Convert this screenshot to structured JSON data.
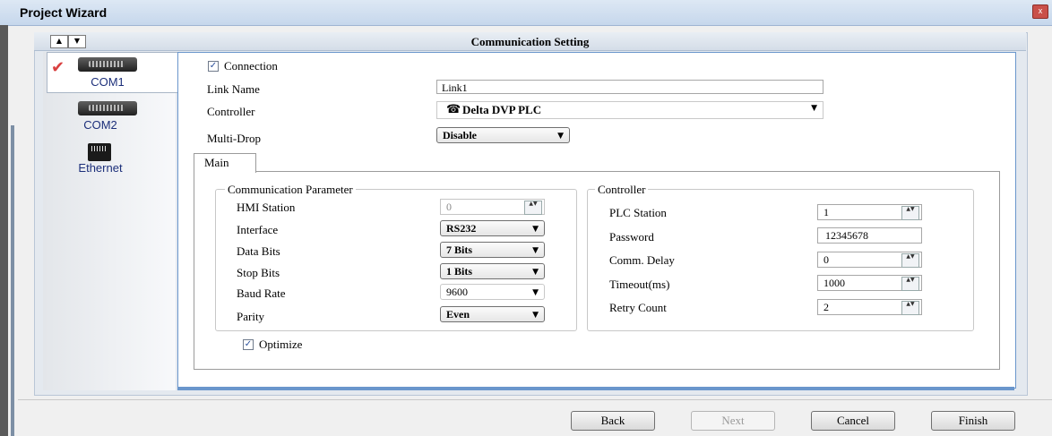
{
  "window": {
    "title": "Project Wizard",
    "close_label": "x"
  },
  "panel": {
    "title": "Communication Setting",
    "up_arrow": "▲",
    "down_arrow": "▼"
  },
  "sidebar": {
    "items": [
      {
        "label": "COM1",
        "icon": "serial-port-icon",
        "selected": true
      },
      {
        "label": "COM2",
        "icon": "serial-port-icon",
        "selected": false
      },
      {
        "label": "Ethernet",
        "icon": "ethernet-port-icon",
        "selected": false
      }
    ],
    "check_glyph": "✔"
  },
  "connection": {
    "checkbox_label": "Connection",
    "checked": true,
    "link_name_label": "Link Name",
    "link_name_value": "Link1",
    "controller_label": "Controller",
    "controller_value": "Delta DVP PLC",
    "multidrop_label": "Multi-Drop",
    "multidrop_value": "Disable"
  },
  "tabs": [
    {
      "label": "Main",
      "active": true
    }
  ],
  "comm_params": {
    "title": "Communication Parameter",
    "hmi_station": {
      "label": "HMI Station",
      "value": "0"
    },
    "interface": {
      "label": "Interface",
      "value": "RS232"
    },
    "data_bits": {
      "label": "Data Bits",
      "value": "7 Bits"
    },
    "stop_bits": {
      "label": "Stop Bits",
      "value": "1 Bits"
    },
    "baud_rate": {
      "label": "Baud Rate",
      "value": "9600"
    },
    "parity": {
      "label": "Parity",
      "value": "Even"
    }
  },
  "controller_group": {
    "title": "Controller",
    "plc_station": {
      "label": "PLC Station",
      "value": "1"
    },
    "password": {
      "label": "Password",
      "value": "12345678"
    },
    "comm_delay": {
      "label": "Comm. Delay",
      "value": "0"
    },
    "timeout": {
      "label": "Timeout(ms)",
      "value": "1000"
    },
    "retry_count": {
      "label": "Retry Count",
      "value": "2"
    }
  },
  "optimize": {
    "label": "Optimize",
    "checked": true
  },
  "buttons": {
    "back": "Back",
    "next": "Next",
    "cancel": "Cancel",
    "finish": "Finish"
  },
  "glyphs": {
    "check": "✓",
    "dropdown": "▼",
    "spin": "▲▼"
  },
  "colors": {
    "accent": "#6a96cc",
    "title_bg": "#c6d7ec",
    "nav_text": "#1c2f7a",
    "check_red": "#d94040"
  }
}
